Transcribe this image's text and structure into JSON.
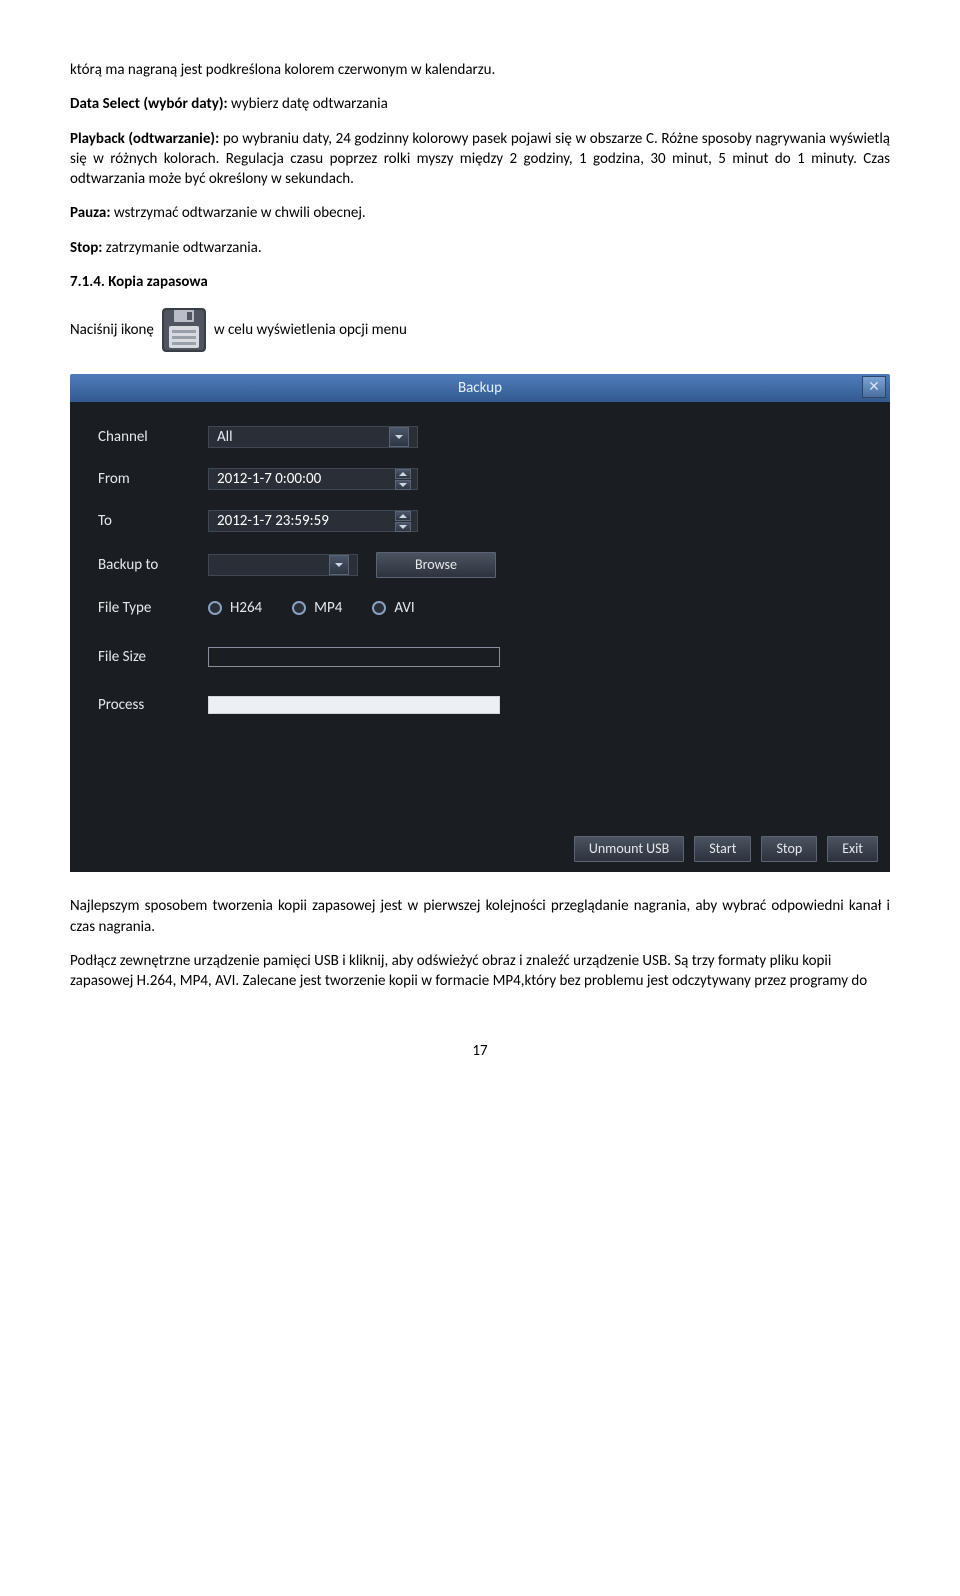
{
  "para1": "którą ma nagraną jest podkreślona kolorem czerwonym w kalendarzu.",
  "para2_lead": "Data Select (wybór daty):",
  "para2_rest": " wybierz datę odtwarzania",
  "para3_lead": "Playback (odtwarzanie):",
  "para3_rest": " po wybraniu daty, 24 godzinny kolorowy pasek pojawi się w obszarze C. Różne sposoby nagrywania wyświetlą się w różnych kolorach. Regulacja czasu poprzez rolki myszy między 2 godziny, 1 godzina, 30 minut, 5 minut do 1 minuty. Czas odtwarzania może być określony w  sekundach.",
  "para4_lead": "Pauza:",
  "para4_rest": " wstrzymać odtwarzanie w chwili obecnej.",
  "para5_lead": "Stop:",
  "para5_rest": " zatrzymanie odtwarzania.",
  "heading": "7.1.4. Kopia zapasowa",
  "icon_row_pre": "Naciśnij ikonę ",
  "icon_row_post": " w celu wyświetlenia opcji menu",
  "dialog": {
    "title": "Backup",
    "close": "✕",
    "labels": {
      "channel": "Channel",
      "from": "From",
      "to": "To",
      "backup_to": "Backup to",
      "file_type": "File Type",
      "file_size": "File Size",
      "process": "Process"
    },
    "values": {
      "channel_sel": "All",
      "from_val": "2012-1-7 0:00:00",
      "to_val": "2012-1-7 23:59:59",
      "backup_to_sel": ""
    },
    "browse_btn": "Browse",
    "file_types": {
      "h264": "H264",
      "mp4": "MP4",
      "avi": "AVI"
    },
    "footer": {
      "unmount": "Unmount USB",
      "start": "Start",
      "stop": "Stop",
      "exit": "Exit"
    }
  },
  "para6": "Najlepszym sposobem tworzenia kopii zapasowej jest w pierwszej kolejności przeglądanie nagrania, aby wybrać odpowiedni kanał i czas nagrania.",
  "para7": "Podłącz zewnętrzne urządzenie pamięci USB i kliknij, aby odświeżyć obraz i znaleźć urządzenie USB. Są trzy formaty pliku kopii zapasowej H.264, MP4, AVI. Zalecane jest tworzenie kopii w formacie MP4,który bez problemu jest odczytywany przez programy do",
  "page_number": "17"
}
